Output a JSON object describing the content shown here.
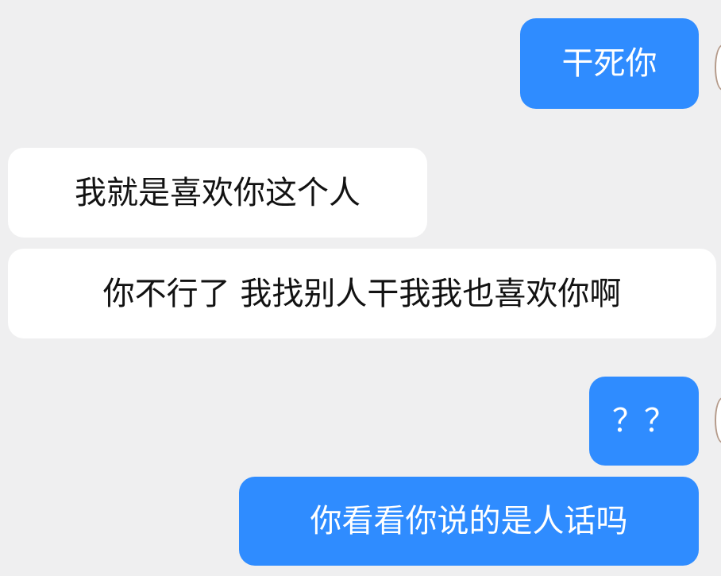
{
  "chat": {
    "messages": [
      {
        "side": "right",
        "text": "干死你"
      },
      {
        "side": "left",
        "text": "我就是喜欢你这个人"
      },
      {
        "side": "left",
        "text": "你不行了 我找别人干我我也喜欢你啊"
      },
      {
        "side": "right",
        "text": "？？"
      },
      {
        "side": "right",
        "text": "你看看你说的是人话吗"
      }
    ]
  },
  "colors": {
    "background": "#efeff0",
    "sent_bubble": "#2f8cff",
    "received_bubble": "#ffffff",
    "sent_text": "#ffffff",
    "received_text": "#121212"
  }
}
